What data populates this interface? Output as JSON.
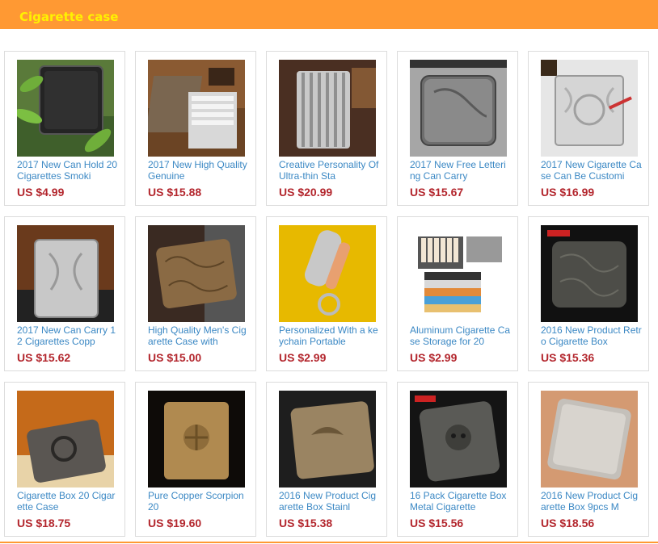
{
  "header": {
    "title": "Cigarette case",
    "bar_color": "#ff9933",
    "title_color": "#fff200"
  },
  "products": [
    {
      "name": "2017 New Can Hold 20 Cigarettes Smoki",
      "price": "US $4.99",
      "image": "black-leather-case-with-plant"
    },
    {
      "name": "2017 New High Quality Genuine",
      "price": "US $15.88",
      "image": "open-steel-case-on-wood"
    },
    {
      "name": "Creative Personality Of Ultra-thin Sta",
      "price": "US $20.99",
      "image": "striped-silver-case"
    },
    {
      "name": "2017 New Free Lettering Can Carry",
      "price": "US $15.67",
      "image": "engraved-silver-case"
    },
    {
      "name": "2017 New Cigarette Case Can Be Customi",
      "price": "US $16.99",
      "image": "ornate-silver-case"
    },
    {
      "name": "2017 New Can Carry 12 Cigarettes Copp",
      "price": "US $15.62",
      "image": "silver-case-on-leather"
    },
    {
      "name": "High Quality Men's Cigarette Case with",
      "price": "US $15.00",
      "image": "bronze-floral-case"
    },
    {
      "name": "Personalized With a keychain Portable",
      "price": "US $2.99",
      "image": "tube-keychain-case"
    },
    {
      "name": "Aluminum Cigarette Case Storage for 20",
      "price": "US $2.99",
      "image": "colorful-aluminum-cases"
    },
    {
      "name": "2016 New Product Retro Cigarette Box",
      "price": "US $15.36",
      "image": "dark-retro-case"
    },
    {
      "name": "Cigarette Box 20 Cigarette Case",
      "price": "US $18.75",
      "image": "emblem-metal-case"
    },
    {
      "name": "Pure Copper Scorpion 20",
      "price": "US $19.60",
      "image": "copper-scorpion-case"
    },
    {
      "name": "2016 New Product Cigarette Box Stainl",
      "price": "US $15.38",
      "image": "bronze-eagle-case"
    },
    {
      "name": "16 Pack Cigarette Box Metal Cigarette",
      "price": "US $15.56",
      "image": "skull-metal-case"
    },
    {
      "name": "2016 New Product Cigarette Box 9pcs M",
      "price": "US $18.56",
      "image": "brushed-steel-case"
    }
  ],
  "colors": {
    "title": "#3b88c4",
    "price": "#b3262d",
    "border": "#dcdcdc"
  }
}
